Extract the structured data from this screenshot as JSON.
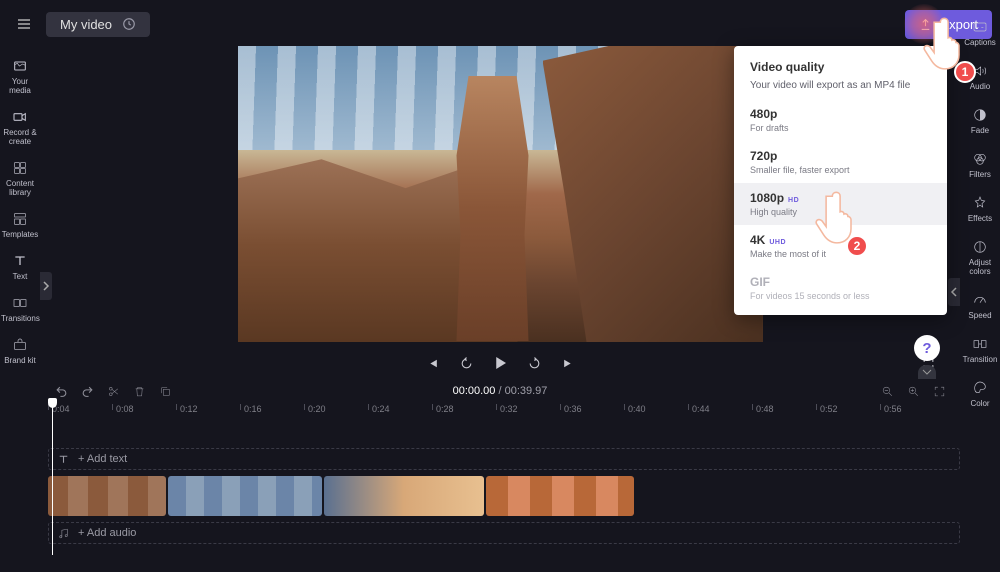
{
  "topbar": {
    "title": "My video",
    "export_label": "Export"
  },
  "left_sidebar": {
    "items": [
      {
        "label": "Your media",
        "icon": "media-icon"
      },
      {
        "label": "Record & create",
        "icon": "record-icon"
      },
      {
        "label": "Content library",
        "icon": "library-icon"
      },
      {
        "label": "Templates",
        "icon": "templates-icon"
      },
      {
        "label": "Text",
        "icon": "text-icon"
      },
      {
        "label": "Transitions",
        "icon": "transitions-icon"
      },
      {
        "label": "Brand kit",
        "icon": "brandkit-icon"
      }
    ]
  },
  "right_sidebar": {
    "items": [
      {
        "label": "Captions",
        "icon": "captions-icon"
      },
      {
        "label": "Audio",
        "icon": "audio-icon"
      },
      {
        "label": "Fade",
        "icon": "fade-icon"
      },
      {
        "label": "Filters",
        "icon": "filters-icon"
      },
      {
        "label": "Effects",
        "icon": "effects-icon"
      },
      {
        "label": "Adjust colors",
        "icon": "adjust-icon"
      },
      {
        "label": "Speed",
        "icon": "speed-icon"
      },
      {
        "label": "Transition",
        "icon": "transition-icon"
      },
      {
        "label": "Color",
        "icon": "color-icon"
      }
    ]
  },
  "player": {
    "time_current": "00:00.00",
    "time_total": "00:39.97"
  },
  "timeline": {
    "marks": [
      "0:04",
      "0:08",
      "0:12",
      "0:16",
      "0:20",
      "0:24",
      "0:28",
      "0:32",
      "0:36",
      "0:40",
      "0:44",
      "0:48",
      "0:52",
      "0:56"
    ],
    "text_track_label": "+ Add text",
    "audio_track_label": "+ Add audio"
  },
  "export_panel": {
    "title": "Video quality",
    "subtitle": "Your video will export as an MP4 file",
    "options": [
      {
        "title": "480p",
        "sub": "For drafts",
        "badge": ""
      },
      {
        "title": "720p",
        "sub": "Smaller file, faster export",
        "badge": ""
      },
      {
        "title": "1080p",
        "sub": "High quality",
        "badge": "HD"
      },
      {
        "title": "4K",
        "sub": "Make the most of it",
        "badge": "UHD"
      },
      {
        "title": "GIF",
        "sub": "For videos 15 seconds or less",
        "badge": ""
      }
    ]
  },
  "annotations": {
    "pointer1": "1",
    "pointer2": "2"
  },
  "help": {
    "label": "?"
  }
}
